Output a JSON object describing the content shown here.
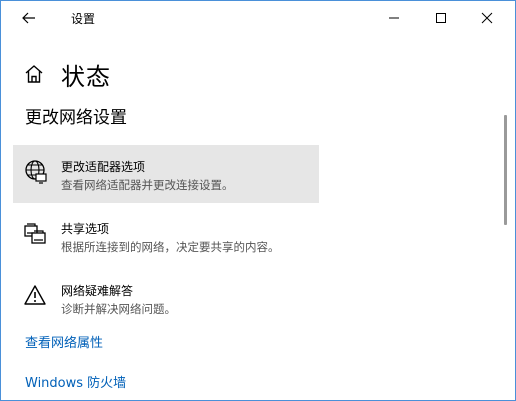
{
  "window": {
    "title": "设置"
  },
  "header": {
    "title": "状态"
  },
  "section": {
    "title": "更改网络设置"
  },
  "items": [
    {
      "title": "更改适配器选项",
      "desc": "查看网络适配器并更改连接设置。",
      "icon": "globe-monitor-icon"
    },
    {
      "title": "共享选项",
      "desc": "根据所连接到的网络，决定要共享的内容。",
      "icon": "sharing-printer-icon"
    },
    {
      "title": "网络疑难解答",
      "desc": "诊断并解决网络问题。",
      "icon": "warning-icon"
    }
  ],
  "links": {
    "network_properties": "查看网络属性",
    "firewall": "Windows 防火墙"
  },
  "colors": {
    "link": "#0060b8",
    "hover_bg": "#e6e6e6",
    "border": "#4a90d9"
  }
}
